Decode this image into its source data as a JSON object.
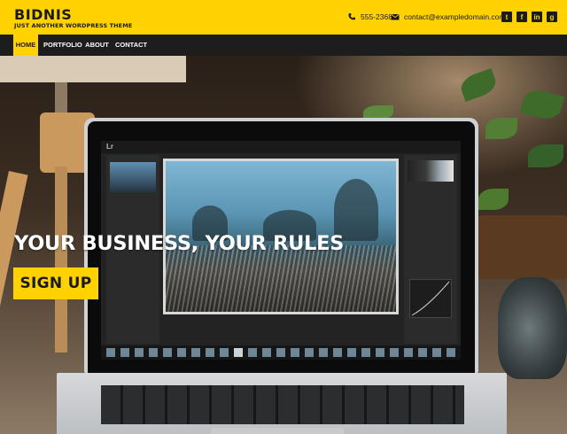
{
  "site": {
    "title": "BIDNIS",
    "tagline": "JUST ANOTHER WORDPRESS THEME"
  },
  "contact": {
    "phone": "555-2368",
    "phone_icon": "phone-icon",
    "email": "contact@exampledomain.com",
    "email_icon": "envelope-icon"
  },
  "socials": [
    {
      "icon": "twitter-icon",
      "glyph": "t"
    },
    {
      "icon": "facebook-icon",
      "glyph": "f"
    },
    {
      "icon": "linkedin-icon",
      "glyph": "in"
    },
    {
      "icon": "github-icon",
      "glyph": "g"
    }
  ],
  "nav": {
    "items": [
      {
        "label": "HOME",
        "active": true
      },
      {
        "label": "PORTFOLIO",
        "active": false
      },
      {
        "label": "ABOUT",
        "active": false
      },
      {
        "label": "CONTACT",
        "active": false
      }
    ]
  },
  "hero": {
    "headline": "YOUR BUSINESS, YOUR RULES",
    "cta_label": "SIGN UP"
  },
  "colors": {
    "accent": "#ffd200",
    "dark": "#1d1d1d",
    "text_dark": "#1b1b1b",
    "white": "#ffffff"
  }
}
